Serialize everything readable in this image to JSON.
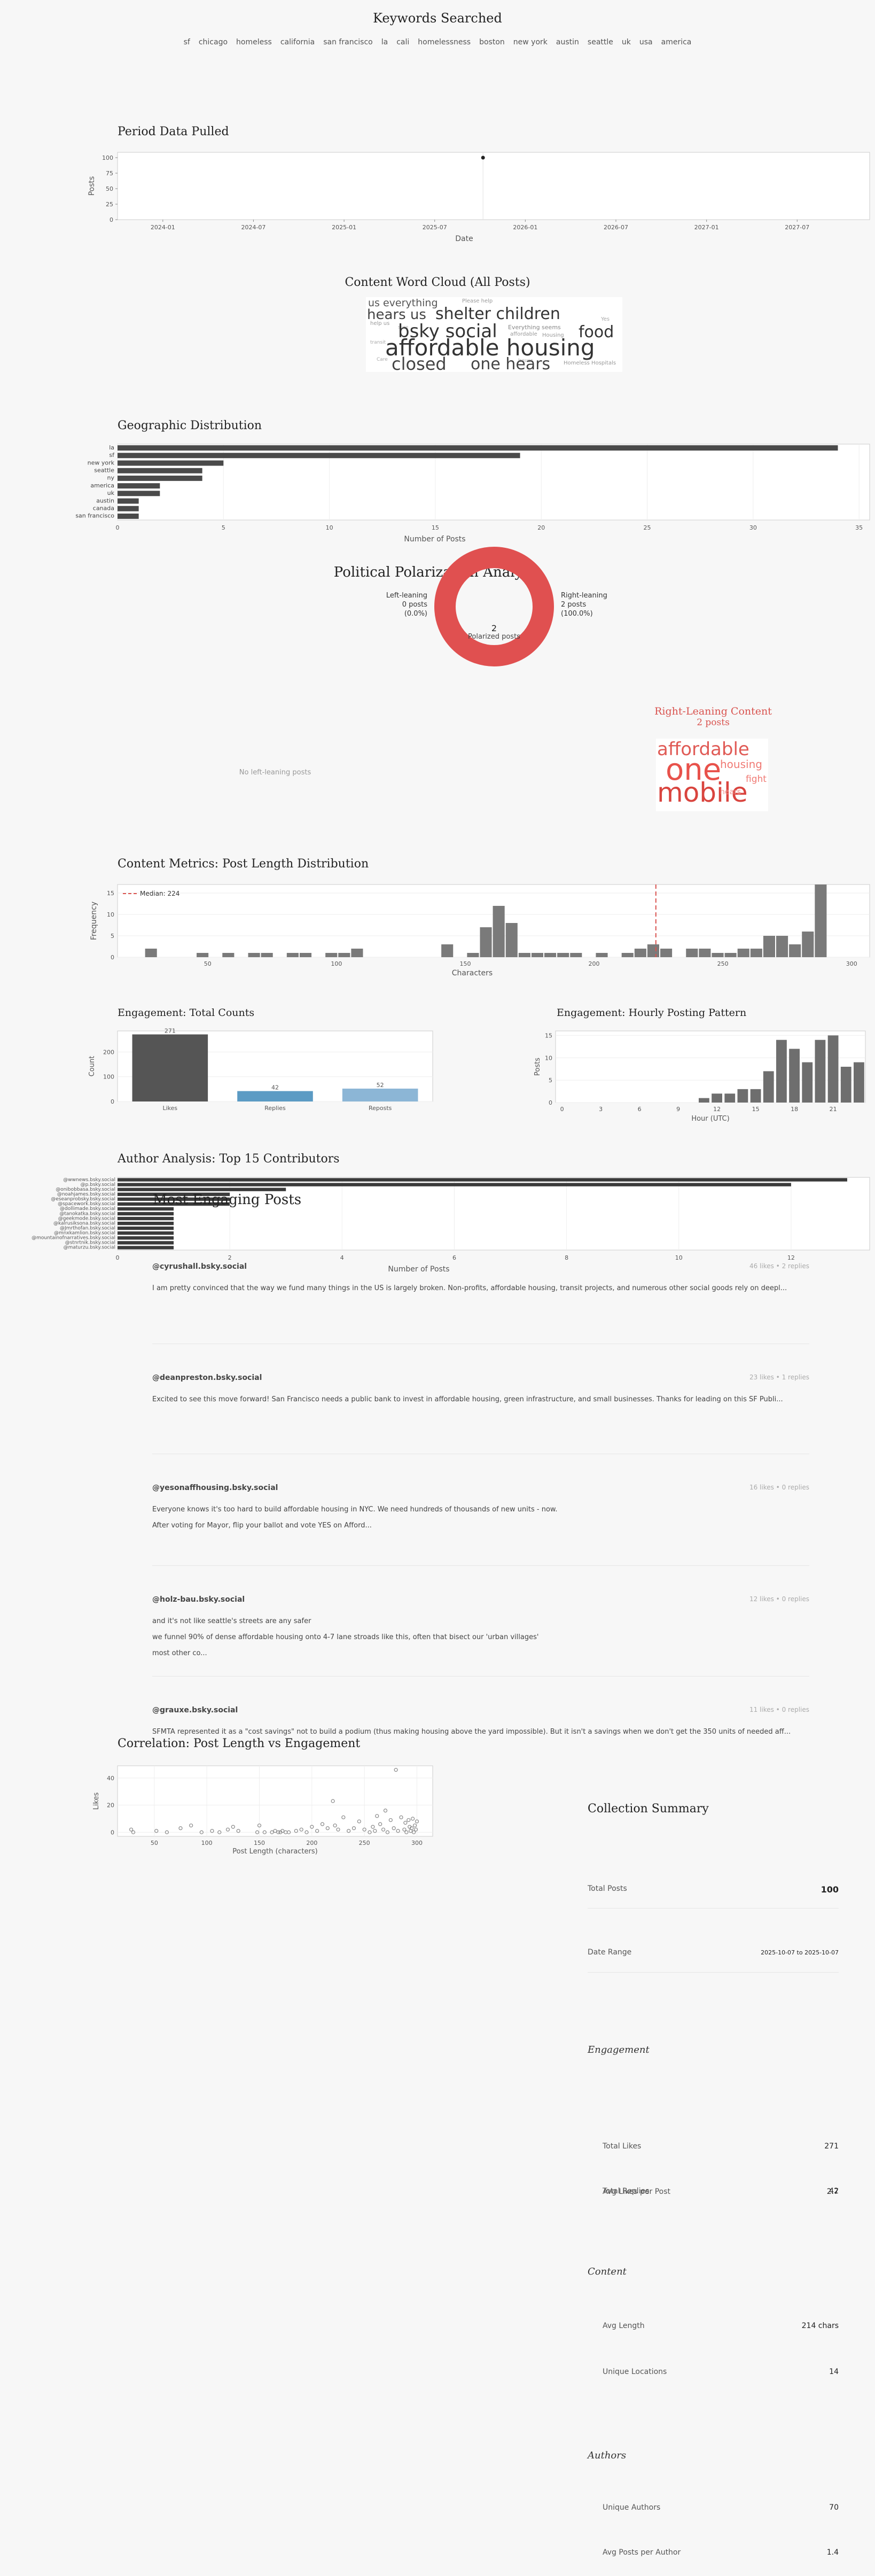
{
  "header": {
    "title": "Keywords Searched",
    "keywords": [
      "sf",
      "chicago",
      "homeless",
      "california",
      "san francisco",
      "la",
      "cali",
      "homelessness",
      "boston",
      "new york",
      "austin",
      "seattle",
      "uk",
      "usa",
      "america"
    ]
  },
  "period": {
    "title": "Period Data Pulled",
    "chart_data": {
      "type": "scatter",
      "xlabel": "Date",
      "ylabel": "Posts",
      "x_ticks": [
        "2024-01",
        "2024-07",
        "2025-01",
        "2025-07",
        "2026-01",
        "2026-07",
        "2027-01",
        "2027-07"
      ],
      "y_ticks": [
        0,
        25,
        50,
        75,
        100
      ],
      "ylim": [
        0,
        100
      ],
      "points": [
        {
          "x": "2025-10-07",
          "y": 100
        }
      ]
    }
  },
  "wordcloud": {
    "title": "Content Word Cloud (All Posts)",
    "big_words": [
      "us everything",
      "hears us",
      "shelter children",
      "bsky social",
      "food",
      "affordable housing",
      "closed",
      "one hears"
    ],
    "small_words": [
      "help us",
      "sure",
      "Everything seems",
      "Housing",
      "Please help",
      "affordable",
      "Yes",
      "Care",
      "Issues",
      "Homeless Hospitals",
      "transit"
    ]
  },
  "geo": {
    "title": "Geographic Distribution",
    "chart_data": {
      "type": "bar",
      "orientation": "horizontal",
      "xlabel": "Number of Posts",
      "categories": [
        "la",
        "sf",
        "new york",
        "seattle",
        "ny",
        "america",
        "uk",
        "austin",
        "canada",
        "san francisco"
      ],
      "values": [
        34,
        19,
        5,
        4,
        4,
        2,
        2,
        1,
        1,
        1
      ],
      "x_ticks": [
        0,
        5,
        10,
        15,
        20,
        25,
        30,
        35
      ],
      "xlim": [
        0,
        35.5
      ]
    }
  },
  "polarization": {
    "title": "Political Polarization Analysis",
    "left_label": "Left-leaning",
    "left_posts": "0 posts",
    "left_pct": "(0.0%)",
    "right_label": "Right-leaning",
    "right_posts": "2 posts",
    "right_pct": "(100.0%)",
    "center_count": "2",
    "center_label": "Polarized posts",
    "chart_data": {
      "type": "pie",
      "categories": [
        "Left-leaning",
        "Right-leaning"
      ],
      "values": [
        0,
        2
      ]
    },
    "no_left": "No left-leaning posts",
    "right_cloud_title": "Right-Leaning Content",
    "right_cloud_sub": "2 posts",
    "right_cloud_words": [
      "affordable",
      "one",
      "mobile",
      "housing",
      "fight",
      "hears"
    ]
  },
  "length": {
    "title": "Content Metrics: Post Length Distribution",
    "legend": "Median: 224",
    "chart_data": {
      "type": "bar",
      "xlabel": "Characters",
      "ylabel": "Frequency",
      "x_ticks": [
        50,
        100,
        150,
        200,
        250,
        300
      ],
      "y_ticks": [
        0,
        5,
        10,
        15
      ],
      "xlim": [
        15,
        307
      ],
      "ylim": [
        0,
        17
      ],
      "median": 224,
      "bin_width": 5,
      "bins": [
        {
          "x": 28,
          "y": 2
        },
        {
          "x": 48,
          "y": 1
        },
        {
          "x": 58,
          "y": 1
        },
        {
          "x": 68,
          "y": 1
        },
        {
          "x": 73,
          "y": 1
        },
        {
          "x": 83,
          "y": 1
        },
        {
          "x": 88,
          "y": 1
        },
        {
          "x": 98,
          "y": 1
        },
        {
          "x": 103,
          "y": 1
        },
        {
          "x": 108,
          "y": 2
        },
        {
          "x": 143,
          "y": 3
        },
        {
          "x": 153,
          "y": 1
        },
        {
          "x": 158,
          "y": 7
        },
        {
          "x": 163,
          "y": 12
        },
        {
          "x": 168,
          "y": 8
        },
        {
          "x": 173,
          "y": 1
        },
        {
          "x": 178,
          "y": 1
        },
        {
          "x": 183,
          "y": 1
        },
        {
          "x": 188,
          "y": 1
        },
        {
          "x": 193,
          "y": 1
        },
        {
          "x": 203,
          "y": 1
        },
        {
          "x": 213,
          "y": 1
        },
        {
          "x": 218,
          "y": 2
        },
        {
          "x": 223,
          "y": 3
        },
        {
          "x": 228,
          "y": 2
        },
        {
          "x": 238,
          "y": 2
        },
        {
          "x": 243,
          "y": 2
        },
        {
          "x": 248,
          "y": 1
        },
        {
          "x": 253,
          "y": 1
        },
        {
          "x": 258,
          "y": 2
        },
        {
          "x": 263,
          "y": 2
        },
        {
          "x": 268,
          "y": 5
        },
        {
          "x": 273,
          "y": 5
        },
        {
          "x": 278,
          "y": 3
        },
        {
          "x": 283,
          "y": 6
        },
        {
          "x": 288,
          "y": 17
        }
      ]
    }
  },
  "engagement": {
    "totals_title": "Engagement: Total Counts",
    "totals_chart": {
      "type": "bar",
      "ylabel": "Count",
      "categories": [
        "Likes",
        "Replies",
        "Reposts"
      ],
      "values": [
        271,
        42,
        52
      ],
      "y_ticks": [
        0,
        100,
        200
      ],
      "ylim": [
        0,
        285
      ],
      "colors": [
        "#555555",
        "#5b9bc4",
        "#8cb6d6"
      ]
    },
    "hourly_title": "Engagement: Hourly Posting Pattern",
    "hourly_chart": {
      "type": "bar",
      "xlabel": "Hour (UTC)",
      "ylabel": "Posts",
      "x_ticks": [
        0,
        3,
        6,
        9,
        12,
        15,
        18,
        21
      ],
      "y_ticks": [
        0,
        5,
        10,
        15
      ],
      "xlim": [
        -0.5,
        23.5
      ],
      "ylim": [
        0,
        16
      ],
      "hours": [
        11,
        12,
        13,
        14,
        15,
        16,
        17,
        18,
        19,
        20,
        21,
        22,
        23
      ],
      "values": [
        1,
        2,
        2,
        3,
        3,
        7,
        14,
        12,
        9,
        14,
        15,
        8,
        9
      ]
    }
  },
  "authors": {
    "title": "Author Analysis: Top 15 Contributors",
    "chart_data": {
      "type": "bar",
      "orientation": "horizontal",
      "xlabel": "Number of Posts",
      "categories": [
        "@wwnews.bsky.social",
        "@p.bsky.social",
        "@onibobbasa.bsky.social",
        "@noahjames.bsky.social",
        "@eseanprobsky.bsky.social",
        "@spacework.bsky.social",
        "@dollimade.bsky.social",
        "@tanokatka.bsky.social",
        "@geekmode.bsky.social",
        "@kalrusiksona.bsky.social",
        "@Jmrthofan.bsky.social",
        "@mnxkamlion.bsky.social",
        "@mountainofnarratives.bsky.social",
        "@stnrtnik.bsky.social",
        "@maturzu.bsky.social"
      ],
      "values": [
        13,
        12,
        3,
        2,
        2,
        2,
        1,
        1,
        1,
        1,
        1,
        1,
        1,
        1,
        1
      ],
      "x_ticks": [
        0,
        2,
        4,
        6,
        8,
        10,
        12
      ],
      "xlim": [
        0,
        13.4
      ]
    }
  },
  "engaging": {
    "title": "Most Engaging Posts",
    "posts": [
      {
        "author": "@cyrushall.bsky.social",
        "stats": "46 likes  •  2 replies",
        "lines": [
          "I am pretty convinced that the way we fund many things in the US is largely broken. Non-profits, affordable housing, transit projects, and numerous other social goods rely on deepl..."
        ]
      },
      {
        "author": "@deanpreston.bsky.social",
        "stats": "23 likes  •  1 replies",
        "lines": [
          "Excited to see this move forward! San Francisco needs a public bank to invest in affordable housing, green infrastructure, and small businesses. Thanks for leading on this SF Publi..."
        ]
      },
      {
        "author": "@yesonaffhousing.bsky.social",
        "stats": "16 likes  •  0 replies",
        "lines": [
          "Everyone knows it's too hard to build affordable housing in NYC. We need hundreds of thousands of new units - now.",
          "After voting for Mayor, flip your ballot and vote YES on Afford..."
        ]
      },
      {
        "author": "@holz-bau.bsky.social",
        "stats": "12 likes  •  0 replies",
        "lines": [
          "and it's not like seattle's streets are any safer",
          "we funnel 90% of dense affordable housing onto 4-7 lane stroads like this, often that bisect our 'urban villages'",
          "most other co..."
        ]
      },
      {
        "author": "@grauxe.bsky.social",
        "stats": "11 likes  •  0 replies",
        "lines": [
          "SFMTA represented it as a \"cost savings\" not to build a podium (thus making housing above the yard impossible). But it isn't a savings when we don't get the 350 units of needed aff..."
        ]
      }
    ]
  },
  "correlation": {
    "title": "Correlation: Post Length vs Engagement",
    "chart_data": {
      "type": "scatter",
      "xlabel": "Post Length (characters)",
      "ylabel": "Likes",
      "x_ticks": [
        50,
        100,
        150,
        200,
        250,
        300
      ],
      "y_ticks": [
        0,
        20,
        40
      ],
      "xlim": [
        15,
        315
      ],
      "ylim": [
        -3,
        49
      ],
      "points": [
        [
          28,
          2
        ],
        [
          30,
          0
        ],
        [
          52,
          1
        ],
        [
          62,
          0
        ],
        [
          75,
          3
        ],
        [
          85,
          5
        ],
        [
          95,
          0
        ],
        [
          105,
          1
        ],
        [
          112,
          0
        ],
        [
          120,
          2
        ],
        [
          125,
          4
        ],
        [
          130,
          1
        ],
        [
          148,
          0
        ],
        [
          150,
          5
        ],
        [
          155,
          0
        ],
        [
          162,
          0
        ],
        [
          165,
          1
        ],
        [
          168,
          0
        ],
        [
          170,
          0
        ],
        [
          172,
          1
        ],
        [
          175,
          0
        ],
        [
          178,
          0
        ],
        [
          185,
          1
        ],
        [
          190,
          2
        ],
        [
          195,
          0
        ],
        [
          200,
          4
        ],
        [
          205,
          1
        ],
        [
          210,
          6
        ],
        [
          215,
          3
        ],
        [
          220,
          23
        ],
        [
          222,
          5
        ],
        [
          225,
          2
        ],
        [
          230,
          11
        ],
        [
          235,
          1
        ],
        [
          240,
          3
        ],
        [
          245,
          8
        ],
        [
          250,
          2
        ],
        [
          255,
          0
        ],
        [
          258,
          4
        ],
        [
          260,
          1
        ],
        [
          262,
          12
        ],
        [
          265,
          6
        ],
        [
          268,
          2
        ],
        [
          270,
          16
        ],
        [
          272,
          0
        ],
        [
          275,
          9
        ],
        [
          278,
          3
        ],
        [
          280,
          46
        ],
        [
          282,
          1
        ],
        [
          285,
          11
        ],
        [
          288,
          2
        ],
        [
          289,
          7
        ],
        [
          290,
          0
        ],
        [
          292,
          9
        ],
        [
          293,
          4
        ],
        [
          294,
          1
        ],
        [
          295,
          3
        ],
        [
          296,
          10
        ],
        [
          297,
          0
        ],
        [
          298,
          5
        ],
        [
          299,
          2
        ],
        [
          300,
          8
        ]
      ]
    }
  },
  "summary": {
    "title": "Collection Summary",
    "total_posts_label": "Total Posts",
    "total_posts": "100",
    "date_range_label": "Date Range",
    "date_range": "2025-10-07 to 2025-10-07",
    "engagement_head": "Engagement",
    "total_likes_label": "Total Likes",
    "total_likes": "271",
    "total_replies_label": "Total Replies",
    "total_replies": "42",
    "avg_likes_label": "Avg Likes per Post",
    "avg_likes": "2.7",
    "content_head": "Content",
    "avg_length_label": "Avg Length",
    "avg_length": "214 chars",
    "unique_loc_label": "Unique Locations",
    "unique_loc": "14",
    "authors_head": "Authors",
    "unique_authors_label": "Unique Authors",
    "unique_authors": "70",
    "avg_posts_label": "Avg Posts per Author",
    "avg_posts": "1.4"
  }
}
